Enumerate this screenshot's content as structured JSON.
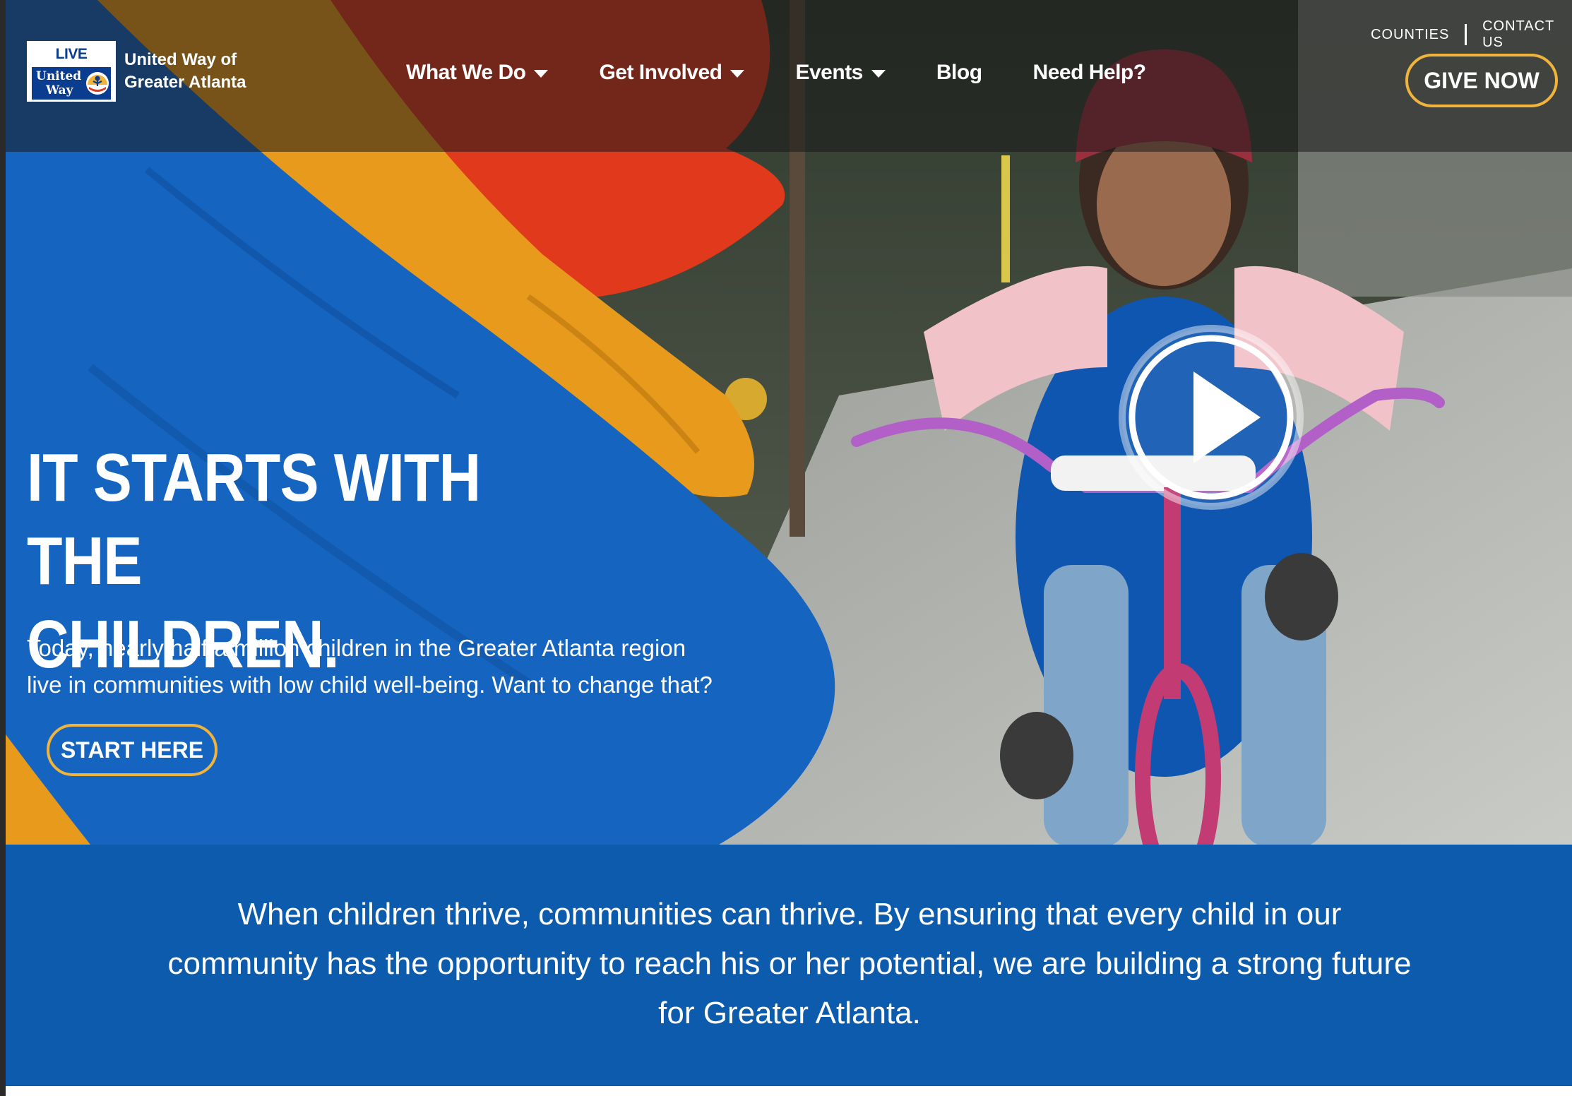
{
  "brand": {
    "logo_top": "LIVE UNITED",
    "logo_word_1": "United",
    "logo_word_2": "Way",
    "name_line_1": "United Way of",
    "name_line_2": "Greater Atlanta"
  },
  "nav": {
    "items": [
      {
        "label": "What We Do",
        "has_dropdown": true
      },
      {
        "label": "Get Involved",
        "has_dropdown": true
      },
      {
        "label": "Events",
        "has_dropdown": true
      },
      {
        "label": "Blog",
        "has_dropdown": false
      },
      {
        "label": "Need Help?",
        "has_dropdown": false
      }
    ]
  },
  "utility": {
    "counties": "COUNTIES",
    "contact": "CONTACT US"
  },
  "give_button": "GIVE NOW",
  "hero": {
    "title_line_1": "IT STARTS WITH THE",
    "title_line_2": "CHILDREN.",
    "subtitle_line_1": "Today, nearly half a million children in the Greater Atlanta region",
    "subtitle_line_2": "live in communities with low child well-being. Want to change that?",
    "cta": "START HERE",
    "play_icon": "play-icon"
  },
  "band": {
    "text": "When children thrive, communities can thrive. By ensuring that every child in our community has the opportunity to reach his or her potential, we are building a strong future for Greater Atlanta."
  },
  "colors": {
    "accent_gold": "#f0b33c",
    "band_blue": "#0c5bac",
    "logo_blue": "#0a3d8f",
    "paint_blue": "#1565c0",
    "paint_orange": "#e89a1c",
    "paint_red": "#e0391c"
  }
}
